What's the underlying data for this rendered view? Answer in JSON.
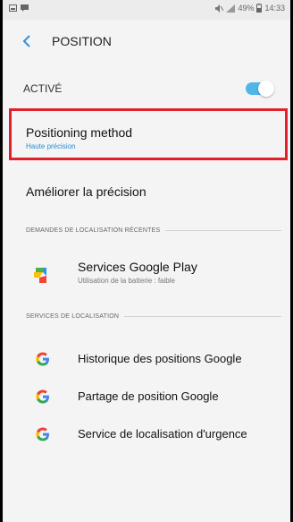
{
  "status_bar": {
    "battery_text": "49%",
    "time": "14:33"
  },
  "header": {
    "title": "POSITION"
  },
  "main_toggle": {
    "label": "ACTIVÉ",
    "state": "on",
    "color": "#4fb6e8"
  },
  "positioning_method": {
    "label": "Positioning method",
    "value": "Haute précision"
  },
  "improve_accuracy": {
    "label": "Améliorer la précision"
  },
  "recent_requests": {
    "header": "DEMANDES DE LOCALISATION RÉCENTES",
    "items": [
      {
        "name": "Services Google Play",
        "subtitle": "Utilisation de la batterie : faible",
        "icon": "google-play-services-icon"
      }
    ]
  },
  "location_services": {
    "header": "SERVICES DE LOCALISATION",
    "items": [
      {
        "label": "Historique des positions Google",
        "icon": "google-g-icon"
      },
      {
        "label": "Partage de position Google",
        "icon": "google-g-icon"
      },
      {
        "label": "Service de localisation d'urgence",
        "icon": "google-g-icon"
      }
    ]
  },
  "highlight_color": "#e0202a",
  "accent_color": "#2a8fd4"
}
